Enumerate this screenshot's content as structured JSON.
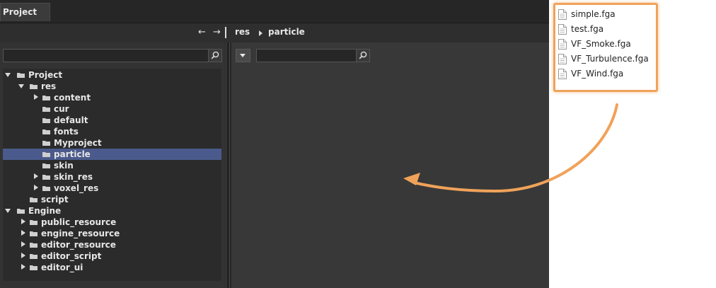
{
  "tab": {
    "label": "Project"
  },
  "path": {
    "back": "←",
    "forward": "→",
    "crumbs": [
      "res",
      "particle"
    ]
  },
  "left_search": {
    "placeholder": "",
    "value": ""
  },
  "right_search": {
    "placeholder": "",
    "value": ""
  },
  "tree": [
    {
      "label": "Project",
      "expander": "open"
    },
    {
      "label": "res",
      "expander": "open"
    },
    {
      "label": "content",
      "expander": "closed"
    },
    {
      "label": "cur",
      "expander": "none"
    },
    {
      "label": "default",
      "expander": "none"
    },
    {
      "label": "fonts",
      "expander": "none"
    },
    {
      "label": "Myproject",
      "expander": "none"
    },
    {
      "label": "particle",
      "expander": "none",
      "selected": true
    },
    {
      "label": "skin",
      "expander": "none"
    },
    {
      "label": "skin_res",
      "expander": "closed"
    },
    {
      "label": "voxel_res",
      "expander": "closed"
    },
    {
      "label": "script",
      "expander": "none"
    },
    {
      "label": "Engine",
      "expander": "open"
    },
    {
      "label": "public_resource",
      "expander": "closed"
    },
    {
      "label": "engine_resource",
      "expander": "closed"
    },
    {
      "label": "editor_resource",
      "expander": "closed"
    },
    {
      "label": "editor_script",
      "expander": "closed"
    },
    {
      "label": "editor_ui",
      "expander": "closed"
    }
  ],
  "files": [
    "simple.fga",
    "test.fga",
    "VF_Smoke.fga",
    "VF_Turbulence.fga",
    "VF_Wind.fga"
  ],
  "colors": {
    "selection": "#4b5a8c",
    "highlight_border": "#f0a25a",
    "arrow": "#f0a25a"
  }
}
